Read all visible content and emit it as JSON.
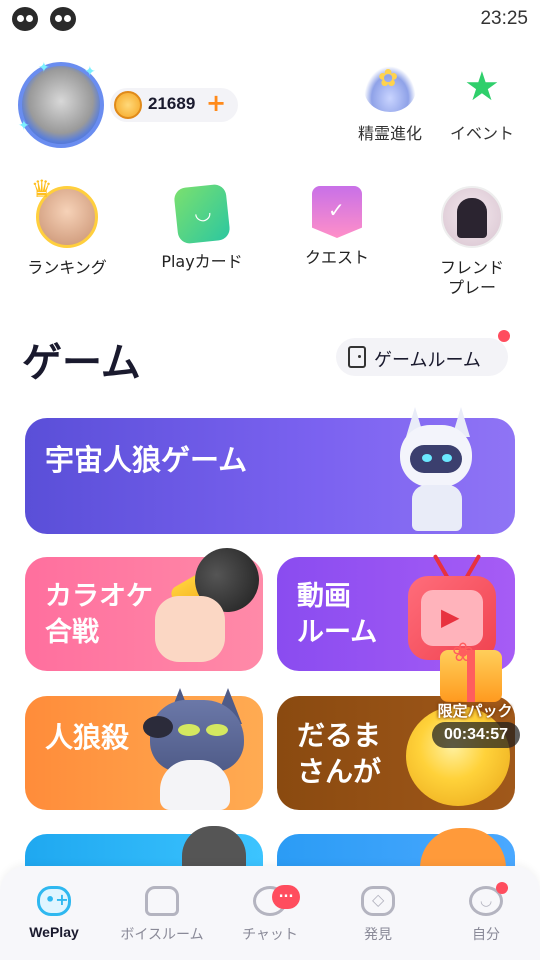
{
  "status_bar": {
    "time": "23:25"
  },
  "profile": {
    "coins": "21689",
    "coin_add": "+"
  },
  "top_actions": [
    {
      "label": "精霊進化",
      "icon": "spirit-evolution-icon"
    },
    {
      "label": "イベント",
      "icon": "event-star-icon"
    }
  ],
  "quick_row": [
    {
      "label": "ランキング",
      "icon": "ranking-avatar-icon"
    },
    {
      "label": "Playカード",
      "icon": "play-card-icon"
    },
    {
      "label": "クエスト",
      "icon": "quest-icon"
    },
    {
      "label": "フレンド\nプレー",
      "icon": "friend-play-avatar-icon"
    }
  ],
  "game_section": {
    "title": "ゲーム",
    "room_button": "ゲームルーム"
  },
  "games": [
    {
      "title": "宇宙人狼ゲーム",
      "color": "#6a58e8"
    },
    {
      "title": "カラオケ\n合戦",
      "color": "#ff7a9f"
    },
    {
      "title": "動画\nルーム",
      "color": "#9a52f2"
    },
    {
      "title": "人狼殺",
      "color": "#ff9a44"
    },
    {
      "title": "だるま\nさんが",
      "color": "#964f14"
    }
  ],
  "promo": {
    "label": "限定パック",
    "timer": "00:34:57"
  },
  "bottom_nav": [
    {
      "label": "WePlay",
      "icon": "weplay-gamepad-icon",
      "active": true
    },
    {
      "label": "ボイスルーム",
      "icon": "sofa-icon",
      "active": false
    },
    {
      "label": "チャット",
      "icon": "chat-bubble-icon",
      "active": false,
      "badge": "..."
    },
    {
      "label": "発見",
      "icon": "discover-icon",
      "active": false
    },
    {
      "label": "自分",
      "icon": "profile-face-icon",
      "active": false
    }
  ],
  "colors": {
    "accent_red": "#ff4d5e",
    "accent_blue": "#2fb8f0",
    "coin_orange": "#ff8a1a"
  }
}
